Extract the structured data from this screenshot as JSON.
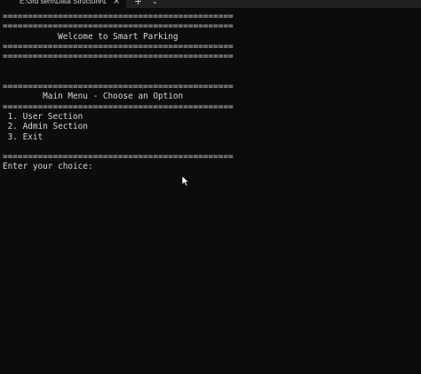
{
  "window": {
    "tab_title": "E:\\3rd sem\\Data Structure\\DS",
    "tab_close_glyph": "×",
    "new_tab_glyph": "+",
    "dropdown_glyph": "⌄"
  },
  "console": {
    "separator": "==============================================",
    "welcome": "           Welcome to Smart Parking",
    "menu_title": "        Main Menu - Choose an Option",
    "options": [
      " 1. User Section",
      " 2. Admin Section",
      " 3. Exit"
    ],
    "prompt": "Enter your choice:"
  },
  "icons": {
    "cursor": "mouse-pointer-icon"
  },
  "colors": {
    "background": "#0c0c0c",
    "text": "#d4d4d4",
    "titlebar": "#202020"
  }
}
